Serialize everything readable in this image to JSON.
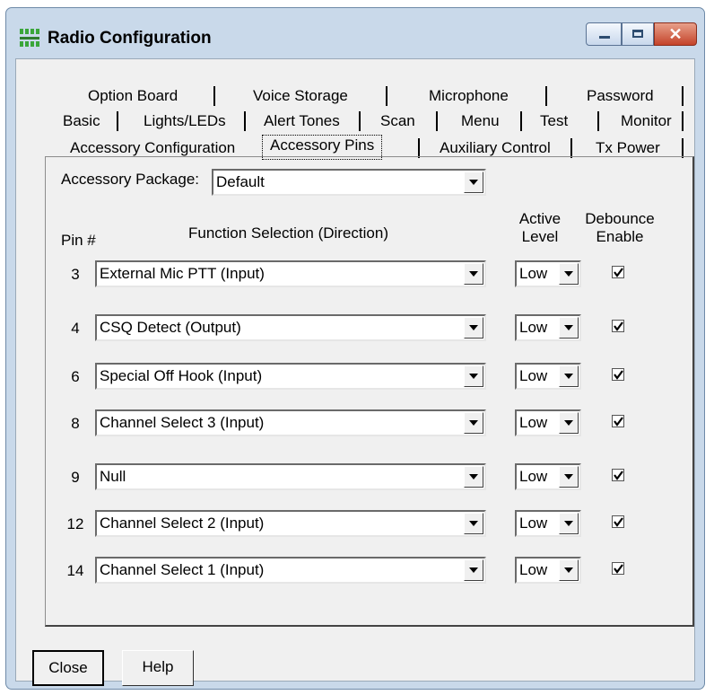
{
  "window": {
    "title": "Radio Configuration"
  },
  "tabs": {
    "row1": [
      "Option Board",
      "Voice Storage",
      "Microphone",
      "Password"
    ],
    "row2": [
      "Basic",
      "Lights/LEDs",
      "Alert Tones",
      "Scan",
      "Menu",
      "Test",
      "Monitor"
    ],
    "row3": [
      "Accessory Configuration",
      "Accessory Pins",
      "Auxiliary Control",
      "Tx Power"
    ],
    "selected": "Accessory Pins"
  },
  "accessory_package": {
    "label": "Accessory Package:",
    "value": "Default"
  },
  "columns": {
    "pin": "Pin #",
    "function": "Function Selection (Direction)",
    "active_level_line1": "Active",
    "active_level_line2": "Level",
    "debounce_line1": "Debounce",
    "debounce_line2": "Enable"
  },
  "pins": [
    {
      "pin": "3",
      "function": "External Mic PTT (Input)",
      "level": "Low",
      "debounce": true
    },
    {
      "pin": "4",
      "function": "CSQ Detect (Output)",
      "level": "Low",
      "debounce": true
    },
    {
      "pin": "6",
      "function": "Special Off Hook (Input)",
      "level": "Low",
      "debounce": true
    },
    {
      "pin": "8",
      "function": "Channel Select 3 (Input)",
      "level": "Low",
      "debounce": true
    },
    {
      "pin": "9",
      "function": "Null",
      "level": "Low",
      "debounce": true
    },
    {
      "pin": "12",
      "function": "Channel Select 2 (Input)",
      "level": "Low",
      "debounce": true
    },
    {
      "pin": "14",
      "function": "Channel Select 1 (Input)",
      "level": "Low",
      "debounce": true
    }
  ],
  "buttons": {
    "close": "Close",
    "help": "Help"
  },
  "icons": {
    "app": "radio-config-icon",
    "minimize": "minimize-icon",
    "maximize": "maximize-icon",
    "close": "close-icon",
    "dropdown": "chevron-down-icon",
    "check": "checkmark-icon"
  },
  "colors": {
    "titlebar": "#c9d9ea",
    "close_button": "#c4432a",
    "app_icon": "#3aa63a"
  }
}
